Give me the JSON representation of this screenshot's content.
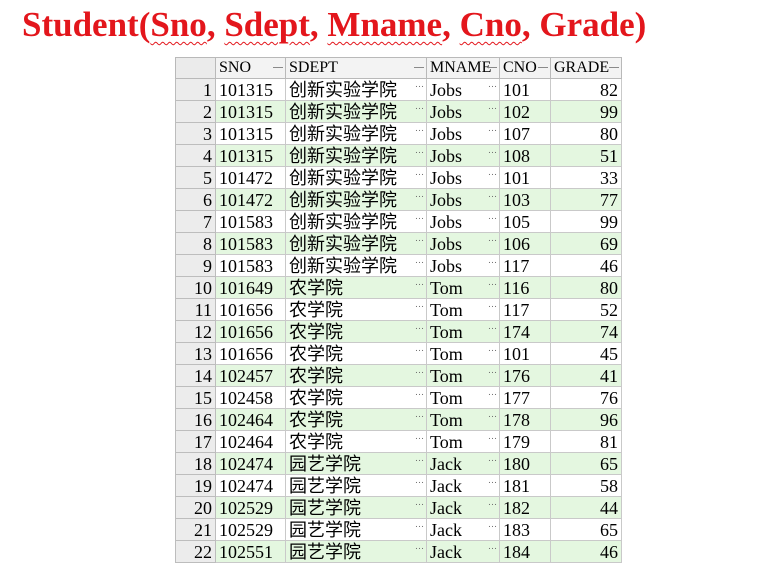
{
  "title": {
    "prefix": "Student(",
    "fields": [
      "Sno",
      "Sdept",
      "Mname",
      "Cno",
      "Grade"
    ],
    "separator": ", ",
    "suffix": ")"
  },
  "grid": {
    "columns": [
      "SNO",
      "SDEPT",
      "MNAME",
      "CNO",
      "GRADE"
    ],
    "rows": [
      {
        "n": "1",
        "sno": "101315",
        "sdept": "创新实验学院",
        "mname": "Jobs",
        "cno": "101",
        "grade": "82"
      },
      {
        "n": "2",
        "sno": "101315",
        "sdept": "创新实验学院",
        "mname": "Jobs",
        "cno": "102",
        "grade": "99"
      },
      {
        "n": "3",
        "sno": "101315",
        "sdept": "创新实验学院",
        "mname": "Jobs",
        "cno": "107",
        "grade": "80"
      },
      {
        "n": "4",
        "sno": "101315",
        "sdept": "创新实验学院",
        "mname": "Jobs",
        "cno": "108",
        "grade": "51"
      },
      {
        "n": "5",
        "sno": "101472",
        "sdept": "创新实验学院",
        "mname": "Jobs",
        "cno": "101",
        "grade": "33"
      },
      {
        "n": "6",
        "sno": "101472",
        "sdept": "创新实验学院",
        "mname": "Jobs",
        "cno": "103",
        "grade": "77"
      },
      {
        "n": "7",
        "sno": "101583",
        "sdept": "创新实验学院",
        "mname": "Jobs",
        "cno": "105",
        "grade": "99"
      },
      {
        "n": "8",
        "sno": "101583",
        "sdept": "创新实验学院",
        "mname": "Jobs",
        "cno": "106",
        "grade": "69"
      },
      {
        "n": "9",
        "sno": "101583",
        "sdept": "创新实验学院",
        "mname": "Jobs",
        "cno": "117",
        "grade": "46"
      },
      {
        "n": "10",
        "sno": "101649",
        "sdept": "农学院",
        "mname": "Tom",
        "cno": "116",
        "grade": "80"
      },
      {
        "n": "11",
        "sno": "101656",
        "sdept": "农学院",
        "mname": "Tom",
        "cno": "117",
        "grade": "52"
      },
      {
        "n": "12",
        "sno": "101656",
        "sdept": "农学院",
        "mname": "Tom",
        "cno": "174",
        "grade": "74"
      },
      {
        "n": "13",
        "sno": "101656",
        "sdept": "农学院",
        "mname": "Tom",
        "cno": "101",
        "grade": "45"
      },
      {
        "n": "14",
        "sno": "102457",
        "sdept": "农学院",
        "mname": "Tom",
        "cno": "176",
        "grade": "41"
      },
      {
        "n": "15",
        "sno": "102458",
        "sdept": "农学院",
        "mname": "Tom",
        "cno": "177",
        "grade": "76"
      },
      {
        "n": "16",
        "sno": "102464",
        "sdept": "农学院",
        "mname": "Tom",
        "cno": "178",
        "grade": "96"
      },
      {
        "n": "17",
        "sno": "102464",
        "sdept": "农学院",
        "mname": "Tom",
        "cno": "179",
        "grade": "81"
      },
      {
        "n": "18",
        "sno": "102474",
        "sdept": "园艺学院",
        "mname": "Jack",
        "cno": "180",
        "grade": "65"
      },
      {
        "n": "19",
        "sno": "102474",
        "sdept": "园艺学院",
        "mname": "Jack",
        "cno": "181",
        "grade": "58"
      },
      {
        "n": "20",
        "sno": "102529",
        "sdept": "园艺学院",
        "mname": "Jack",
        "cno": "182",
        "grade": "44"
      },
      {
        "n": "21",
        "sno": "102529",
        "sdept": "园艺学院",
        "mname": "Jack",
        "cno": "183",
        "grade": "65"
      },
      {
        "n": "22",
        "sno": "102551",
        "sdept": "园艺学院",
        "mname": "Jack",
        "cno": "184",
        "grade": "46"
      }
    ],
    "ellipsis_glyph": "…",
    "colors": {
      "title": "#e3161c",
      "alt_row": "#e4f7e0",
      "header_bg": "#f3f3f3",
      "rownum_bg": "#ececec"
    }
  }
}
